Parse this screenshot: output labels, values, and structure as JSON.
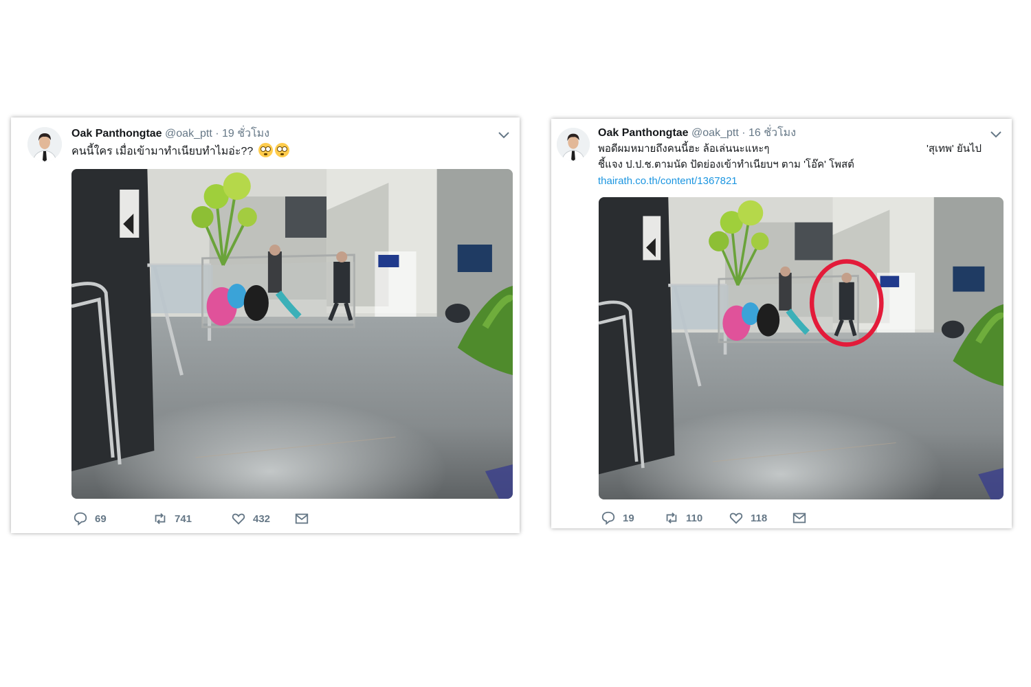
{
  "tweets": [
    {
      "display_name": "Oak Panthongtae",
      "handle": "@oak_ptt",
      "separator": "·",
      "time": "19 ชั่วโมง",
      "text": "คนนี้ใคร เมื่อเข้ามาทำเนียบทำไมอ่ะ??",
      "emoji": [
        "flushed-face",
        "flushed-face"
      ],
      "stats": {
        "replies": "69",
        "retweets": "741",
        "likes": "432"
      }
    },
    {
      "display_name": "Oak Panthongtae",
      "handle": "@oak_ptt",
      "separator": "·",
      "time": "16 ชั่วโมง",
      "text_line1": "พอดีผมหมายถึงคนนี้ฮะ ล้อเล่นนะแหะๆ",
      "text_line1_right": "'สุเทพ' ยันไป",
      "text_line2": "ชี้แจง ป.ป.ช.ตามนัด ปัดย่องเข้าทำเนียบฯ ตาม 'โอ๊ค' โพสต์",
      "link": "thairath.co.th/content/1367821",
      "highlight": "red-circle",
      "stats": {
        "replies": "19",
        "retweets": "110",
        "likes": "118"
      }
    }
  ],
  "colors": {
    "text": "#14171a",
    "muted": "#657786",
    "link": "#1b95e0",
    "highlight": "#e31b3a"
  }
}
